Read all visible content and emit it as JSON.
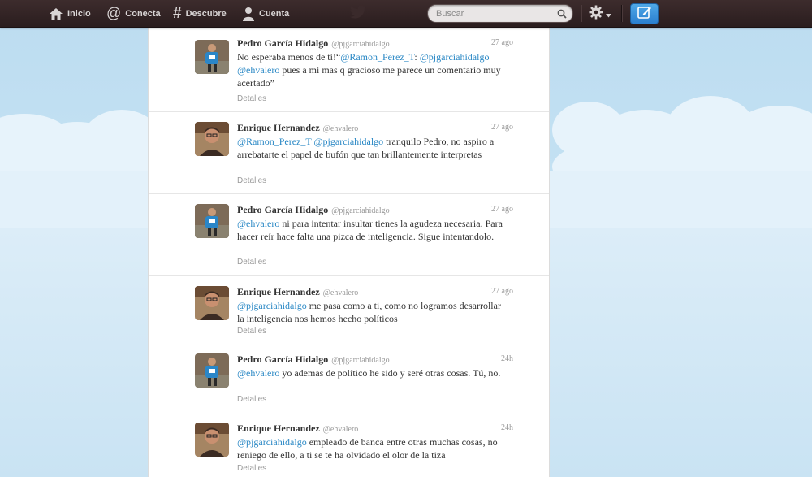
{
  "nav": {
    "home_label": "Inicio",
    "connect_label": "Conecta",
    "discover_label": "Descubre",
    "account_label": "Cuenta",
    "home_icon": "home-icon",
    "connect_icon": "at-icon",
    "discover_icon": "hashtag-icon",
    "account_icon": "person-icon"
  },
  "search": {
    "placeholder": "Buscar"
  },
  "colors": {
    "topbar": "#2f2122",
    "link": "#2a88c5",
    "compose": "#2a7fcf",
    "sky": "#c6e3f4"
  },
  "tweets": [
    {
      "name": "Pedro García Hidalgo",
      "username": "@pjgarciahidalgo",
      "time": "27 ago",
      "text_a": "No esperaba menos de ti!“",
      "m1": "@Ramon_Perez_T",
      "text_b": ": ",
      "m2": "@pjgarciahidalgo",
      "text_c": " ",
      "m3": "@ehvalero",
      "text_d": " pues a mi mas q gracioso me parece un comentario muy acertado”",
      "details": "Detalles"
    },
    {
      "name": "Enrique Hernandez",
      "username": "@ehvalero",
      "time": "27 ago",
      "m1": "@Ramon_Perez_T",
      "text_a": " ",
      "m2": "@pjgarciahidalgo",
      "text_b": " tranquilo Pedro, no aspiro a arrebatarte el papel de bufón que tan brillantemente interpretas",
      "details": "Detalles"
    },
    {
      "name": "Pedro García Hidalgo",
      "username": "@pjgarciahidalgo",
      "time": "27 ago",
      "m1": "@ehvalero",
      "text_a": " ni para intentar insultar tienes la agudeza necesaria. Para hacer reír hace falta una pizca de inteligencia. Sigue intentandolo.",
      "details": "Detalles"
    },
    {
      "name": "Enrique Hernandez",
      "username": "@ehvalero",
      "time": "27 ago",
      "m1": "@pjgarciahidalgo",
      "text_a": " me pasa como a ti, como no logramos desarrollar la inteligencia nos hemos hecho políticos",
      "details": "Detalles"
    },
    {
      "name": "Pedro García Hidalgo",
      "username": "@pjgarciahidalgo",
      "time": "24h",
      "m1": "@ehvalero",
      "text_a": " yo ademas de político he sido y seré otras cosas. Tú, no.",
      "details": "Detalles"
    },
    {
      "name": "Enrique Hernandez",
      "username": "@ehvalero",
      "time": "24h",
      "m1": "@pjgarciahidalgo",
      "text_a": " empleado de banca entre otras muchas cosas, no reniego de ello, a ti se te ha olvidado el olor de la tiza",
      "details": "Detalles"
    }
  ]
}
